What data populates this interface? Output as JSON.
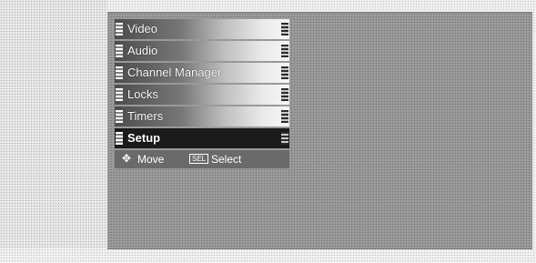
{
  "menu": {
    "items": [
      {
        "label": "Video"
      },
      {
        "label": "Audio"
      },
      {
        "label": "Channel Manager"
      },
      {
        "label": "Locks"
      },
      {
        "label": "Timers"
      },
      {
        "label": "Setup",
        "selected": true
      }
    ]
  },
  "help": {
    "move_icon": "four-way-arrow-icon",
    "move_label": "Move",
    "sel_key": "SEL",
    "select_label": "Select"
  },
  "colors": {
    "screen": "#9a9a9a",
    "selected_item": "#1a1a1a",
    "help_bar": "#6a6a6a"
  }
}
